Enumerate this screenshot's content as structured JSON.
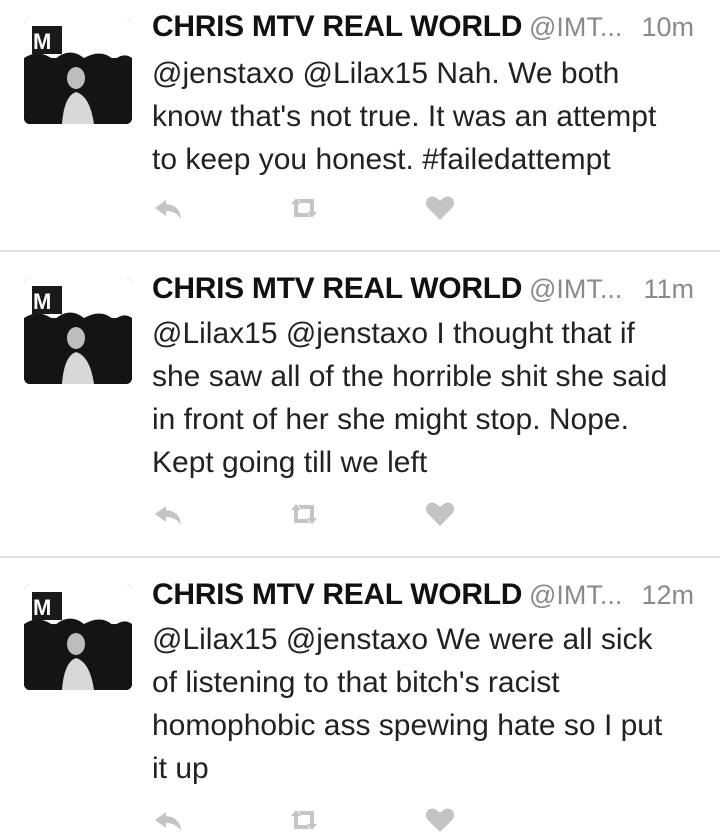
{
  "tweets": [
    {
      "name": "CHRIS MTV REAL WORLD",
      "handle": "@IMT...",
      "time": "10m",
      "lines": [
        "@jenstaxo @Lilax15 Nah. We both",
        "know that's not true. It was an attempt",
        "to keep you honest. #failedattempt"
      ]
    },
    {
      "name": "CHRIS MTV REAL WORLD",
      "handle": "@IMT...",
      "time": "11m",
      "lines": [
        "@Lilax15 @jenstaxo I thought that if",
        "she saw all of the horrible shit she said",
        "in front of her she might stop. Nope.",
        "Kept going till we left"
      ]
    },
    {
      "name": "CHRIS MTV REAL WORLD",
      "handle": "@IMT...",
      "time": "12m",
      "lines": [
        "@Lilax15 @jenstaxo We were all sick",
        "of listening to that bitch's racist",
        "homophobic ass spewing hate so I put",
        "it up"
      ]
    }
  ],
  "icons": {
    "reply": "reply-icon",
    "retweet": "retweet-icon",
    "favorite": "heart-icon"
  },
  "colors": {
    "icon_gray": "#c4c4c4",
    "meta_gray": "#8a8a8a",
    "divider": "#e1e1e1"
  }
}
